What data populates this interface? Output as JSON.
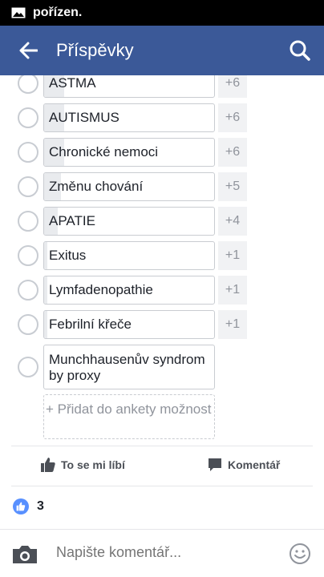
{
  "status_bar": {
    "notification_text": "pořízen."
  },
  "app_bar": {
    "title": "Příspěvky"
  },
  "poll": {
    "options": [
      {
        "label": "ASTMA",
        "count": "+6",
        "fill_fraction": 0.12
      },
      {
        "label": "AUTISMUS",
        "count": "+6",
        "fill_fraction": 0.12
      },
      {
        "label": "Chronické nemoci",
        "count": "+6",
        "fill_fraction": 0.12
      },
      {
        "label": "Změnu chování",
        "count": "+5",
        "fill_fraction": 0.1
      },
      {
        "label": "APATIE",
        "count": "+4",
        "fill_fraction": 0.08
      },
      {
        "label": "Exitus",
        "count": "+1",
        "fill_fraction": 0.02
      },
      {
        "label": "Lymfadenopathie",
        "count": "+1",
        "fill_fraction": 0.02
      },
      {
        "label": "Febrilní křeče",
        "count": "+1",
        "fill_fraction": 0.02
      },
      {
        "label": "Munchhausenův syndrom by proxy",
        "count": "",
        "fill_fraction": 0
      }
    ],
    "add_option_label": "+ Přidat do ankety možnost"
  },
  "actions": {
    "like_label": "To se mi líbí",
    "comment_label": "Komentář"
  },
  "reactions": {
    "count": "3"
  },
  "comment_bar": {
    "placeholder": "Napište komentář..."
  },
  "colors": {
    "brand": "#3b5998",
    "like_blue": "#5890ff"
  }
}
